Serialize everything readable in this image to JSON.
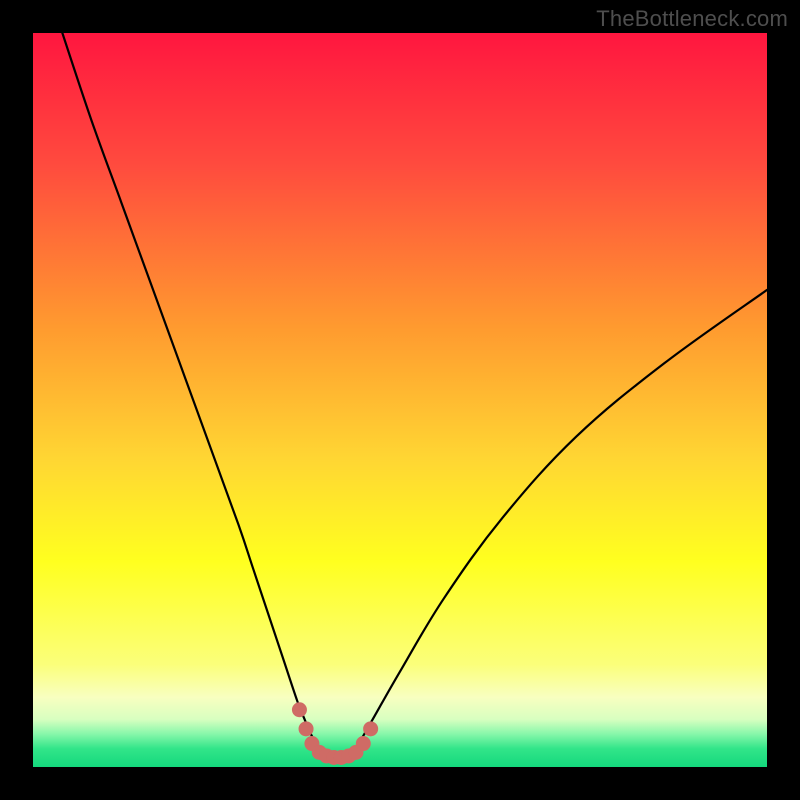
{
  "watermark": "TheBottleneck.com",
  "colors": {
    "frame": "#000000",
    "curve": "#000000",
    "salmon": "#cf6b65",
    "gradient_stops": [
      {
        "offset": 0.0,
        "color": "#ff163f"
      },
      {
        "offset": 0.18,
        "color": "#ff4b3e"
      },
      {
        "offset": 0.4,
        "color": "#ff9a2f"
      },
      {
        "offset": 0.58,
        "color": "#ffd633"
      },
      {
        "offset": 0.72,
        "color": "#ffff1f"
      },
      {
        "offset": 0.86,
        "color": "#fbff7a"
      },
      {
        "offset": 0.905,
        "color": "#f8ffc0"
      },
      {
        "offset": 0.935,
        "color": "#d8ffc0"
      },
      {
        "offset": 0.955,
        "color": "#87f7aa"
      },
      {
        "offset": 0.975,
        "color": "#32e589"
      },
      {
        "offset": 1.0,
        "color": "#14d87d"
      }
    ]
  },
  "chart_data": {
    "type": "line",
    "title": "",
    "xlabel": "",
    "ylabel": "",
    "xlim": [
      0,
      100
    ],
    "ylim": [
      0,
      100
    ],
    "series": [
      {
        "name": "bottleneck-curve",
        "x": [
          4,
          8,
          12,
          16,
          20,
          24,
          28,
          30,
          32,
          34,
          36,
          37,
          38,
          39,
          40,
          41,
          42,
          43,
          44,
          46,
          50,
          56,
          64,
          74,
          86,
          100
        ],
        "y": [
          100,
          88,
          77,
          66,
          55,
          44,
          33,
          27,
          21,
          15,
          9,
          6.5,
          4.2,
          2.6,
          1.6,
          1.2,
          1.2,
          1.6,
          2.6,
          6,
          13,
          23,
          34,
          45,
          55,
          65
        ]
      }
    ],
    "marker_cluster": {
      "name": "salmon-dots",
      "points": [
        {
          "x": 36.3,
          "y": 7.8
        },
        {
          "x": 37.2,
          "y": 5.2
        },
        {
          "x": 38.0,
          "y": 3.2
        },
        {
          "x": 39.0,
          "y": 2.0
        },
        {
          "x": 40.0,
          "y": 1.5
        },
        {
          "x": 41.0,
          "y": 1.3
        },
        {
          "x": 42.0,
          "y": 1.3
        },
        {
          "x": 43.0,
          "y": 1.5
        },
        {
          "x": 44.0,
          "y": 2.0
        },
        {
          "x": 45.0,
          "y": 3.2
        },
        {
          "x": 46.0,
          "y": 5.2
        }
      ],
      "connector": true
    }
  }
}
